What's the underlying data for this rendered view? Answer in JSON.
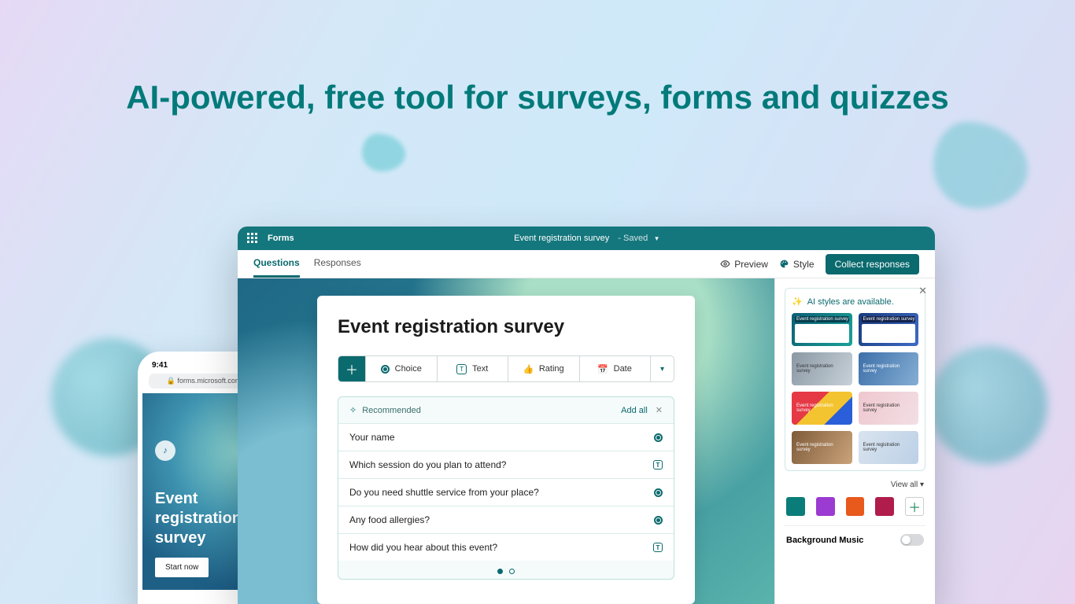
{
  "hero": {
    "headline": "AI-powered, free tool for surveys, forms and quizzes"
  },
  "phone": {
    "time": "9:41",
    "url": "forms.microsoft.com",
    "title": "Event registration survey",
    "start": "Start now"
  },
  "app": {
    "product": "Forms",
    "doc_title": "Event registration survey",
    "save_state": "- Saved",
    "tabs": {
      "questions": "Questions",
      "responses": "Responses"
    },
    "actions": {
      "preview": "Preview",
      "style": "Style",
      "collect": "Collect responses"
    }
  },
  "form": {
    "title": "Event registration survey",
    "qtypes": {
      "choice": "Choice",
      "text": "Text",
      "rating": "Rating",
      "date": "Date"
    },
    "rec": {
      "label": "Recommended",
      "add_all": "Add all",
      "items": [
        {
          "label": "Your name",
          "type": "radio"
        },
        {
          "label": "Which session do you plan to attend?",
          "type": "text"
        },
        {
          "label": "Do you need shuttle service from your place?",
          "type": "radio"
        },
        {
          "label": "Any food allergies?",
          "type": "radio"
        },
        {
          "label": "How did you hear about this event?",
          "type": "text"
        }
      ]
    }
  },
  "panel": {
    "ai_msg": "AI styles are available.",
    "thumb_label": "Event registration survey",
    "view_all": "View all",
    "swatches": [
      "#0a7d7a",
      "#9b3bd1",
      "#e8591c",
      "#b01c4c"
    ],
    "music_label": "Background Music"
  }
}
